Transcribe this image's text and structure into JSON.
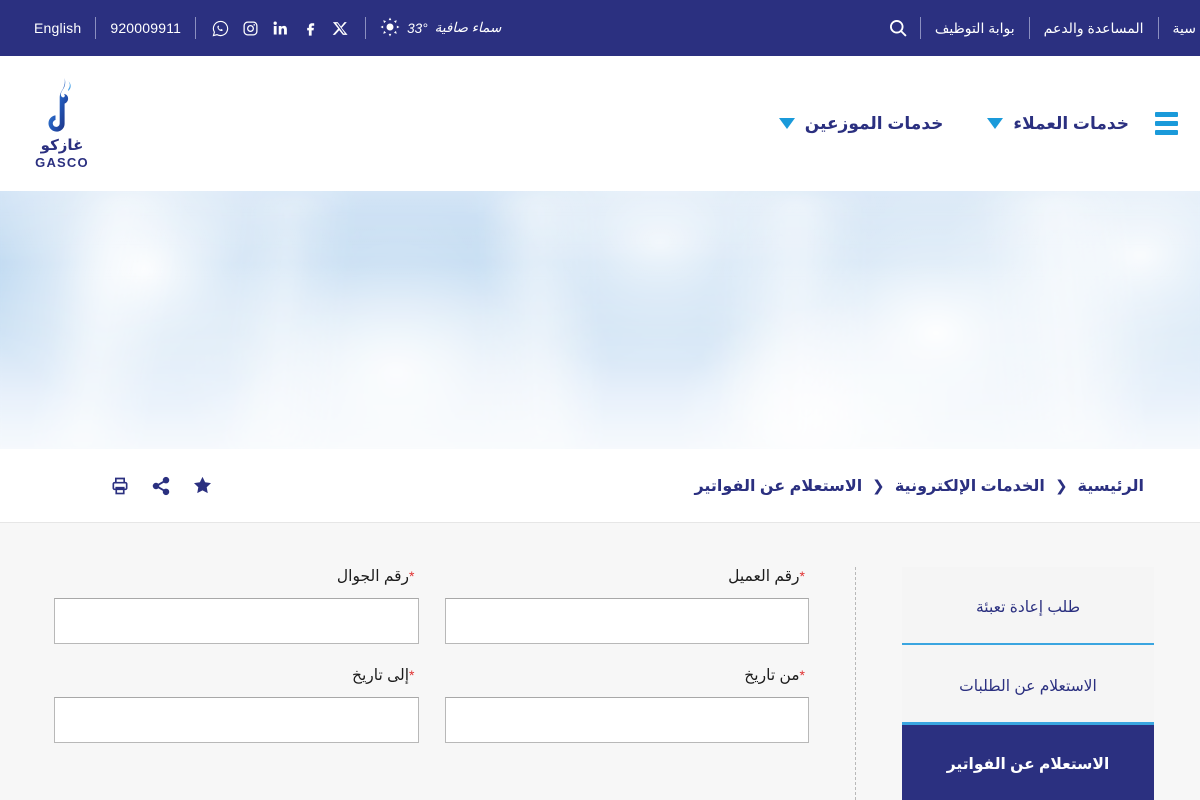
{
  "topbar": {
    "language_link": "English",
    "phone": "920009911",
    "social": [
      {
        "name": "whatsapp-icon",
        "label": "WhatsApp"
      },
      {
        "name": "instagram-icon",
        "label": "Instagram"
      },
      {
        "name": "linkedin-icon",
        "label": "LinkedIn"
      },
      {
        "name": "facebook-icon",
        "label": "Facebook"
      },
      {
        "name": "x-twitter-icon",
        "label": "X"
      }
    ],
    "weather_text": "سماء صافية",
    "weather_temp": "33°",
    "weather_icon": "sun-icon",
    "search_icon": "search-icon",
    "links": [
      {
        "label": "بوابة التوظيف"
      },
      {
        "label": "المساعدة والدعم"
      },
      {
        "label": "سية"
      }
    ]
  },
  "header": {
    "logo": {
      "arabic": "غازكو",
      "english": "GASCO",
      "icon": "gasco-flame-logo"
    },
    "nav": [
      {
        "label": "خدمات العملاء",
        "icon": "chevron-down-icon"
      },
      {
        "label": "خدمات الموزعين",
        "icon": "chevron-down-icon"
      }
    ],
    "menu_icon": "hamburger-menu-icon"
  },
  "hero": {
    "alt": "sky-clouds-banner"
  },
  "crumbbar": {
    "tools": [
      {
        "name": "print-icon",
        "label": "طباعة"
      },
      {
        "name": "share-icon",
        "label": "مشاركة"
      },
      {
        "name": "favorite-star-icon",
        "label": "المفضلة"
      }
    ],
    "breadcrumb": [
      {
        "label": "الرئيسية",
        "current": false
      },
      {
        "label": "الخدمات الإلكترونية",
        "current": false
      },
      {
        "label": "الاستعلام عن الفواتير",
        "current": true
      }
    ],
    "separator": "❯"
  },
  "sidebar": {
    "tabs": [
      {
        "label": "طلب إعادة تعبئة",
        "active": false
      },
      {
        "label": "الاستعلام عن الطلبات",
        "active": false
      },
      {
        "label": "الاستعلام عن الفواتير",
        "active": true
      }
    ]
  },
  "form": {
    "fields": [
      {
        "label": "رقم العميل",
        "required": true,
        "value": "",
        "placeholder": "",
        "name": "customer-number-input"
      },
      {
        "label": "رقم الجوال",
        "required": true,
        "value": "",
        "placeholder": "",
        "name": "mobile-number-input"
      },
      {
        "label": "من تاريخ",
        "required": true,
        "value": "",
        "placeholder": "",
        "name": "from-date-input"
      },
      {
        "label": "إلى تاريخ",
        "required": true,
        "value": "",
        "placeholder": "",
        "name": "to-date-input"
      }
    ],
    "required_marker": "*"
  },
  "colors": {
    "brand_navy": "#2b3080",
    "accent_blue": "#1a9ada",
    "required_red": "#e03131",
    "page_bg": "#f7f7f7"
  }
}
